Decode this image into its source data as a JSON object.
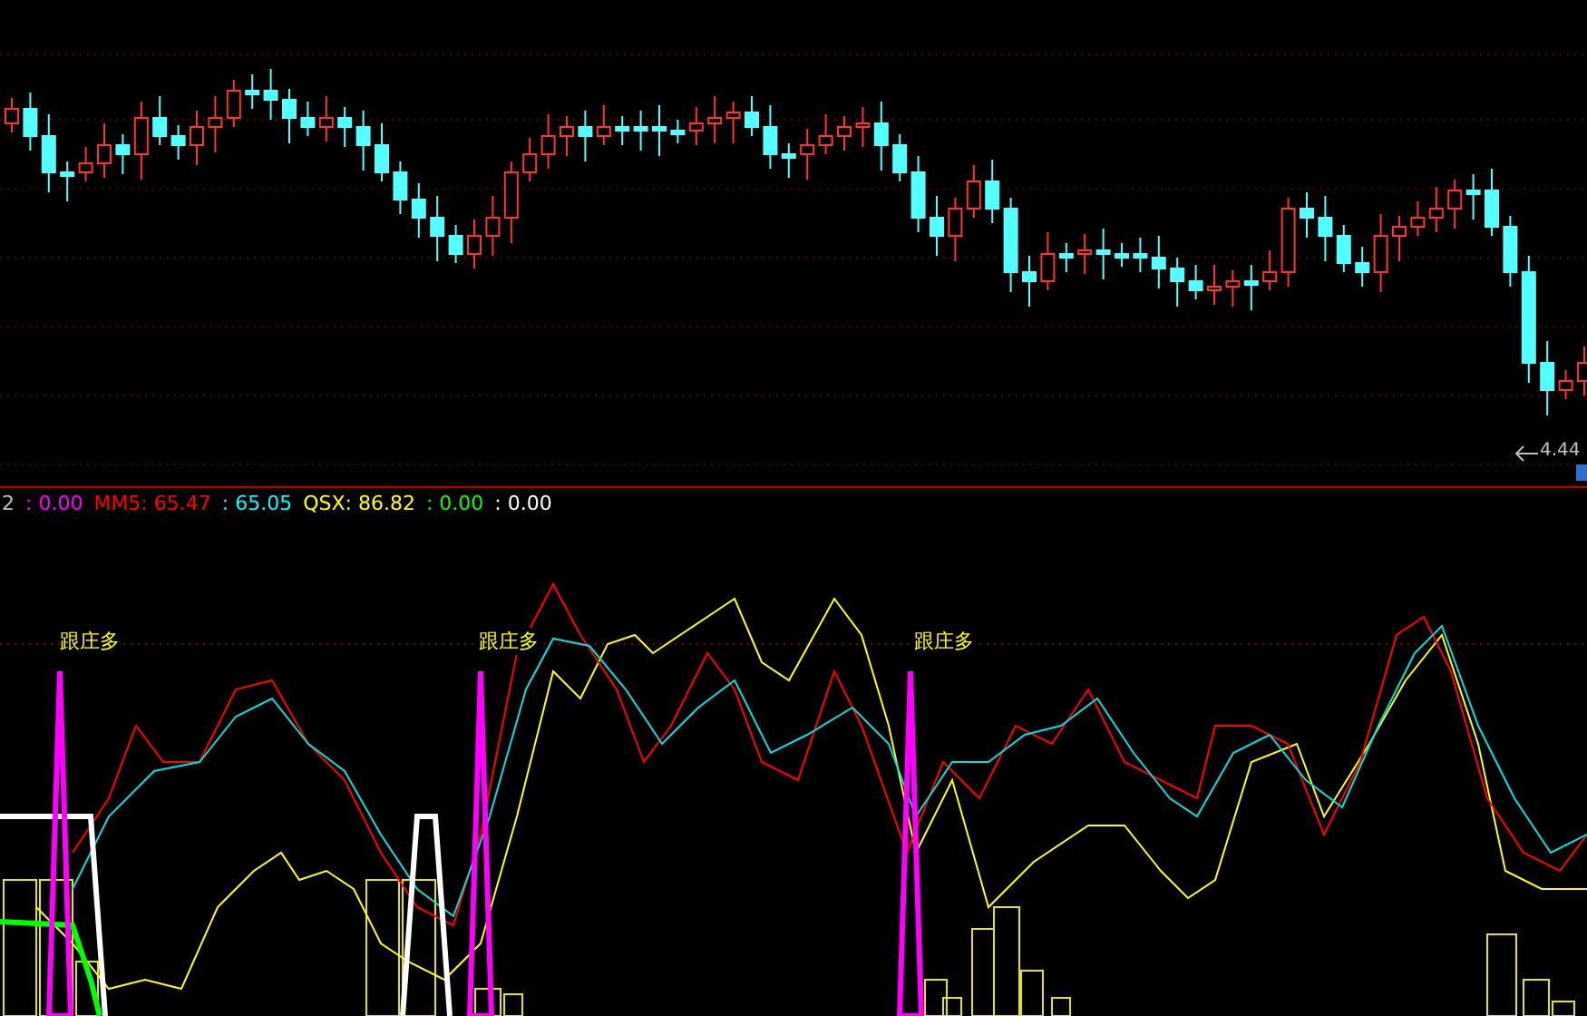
{
  "price_panel": {
    "low_marker": "4.44"
  },
  "indicator_legend": [
    {
      "text": "2",
      "color": "#c0c0c0"
    },
    {
      "text": ": 0.00",
      "color": "#ff00ff"
    },
    {
      "text": "MM5: 65.47",
      "color": "#ff0000"
    },
    {
      "text": ": 65.05",
      "color": "#00ffff"
    },
    {
      "text": "QSX: 86.82",
      "color": "#ffff00"
    },
    {
      "text": ": 0.00",
      "color": "#00ff00"
    },
    {
      "text": ": 0.00",
      "color": "#ffffff"
    }
  ],
  "signals": [
    {
      "label": "跟庄多"
    },
    {
      "label": "跟庄多"
    },
    {
      "label": "跟庄多"
    }
  ]
}
